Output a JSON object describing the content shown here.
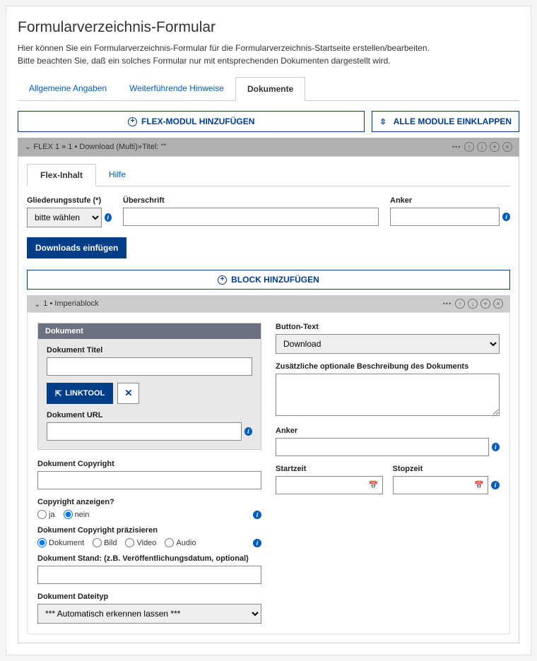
{
  "page": {
    "title": "Formularverzeichnis-Formular",
    "intro1": "Hier können Sie ein Formularverzeichnis-Formular für die Formularverzeichnis-Startseite erstellen/bearbeiten.",
    "intro2": "Bitte beachten Sie, daß ein solches Formular nur mit entsprechenden Dokumenten dargestellt wird."
  },
  "tabs": {
    "t1": "Allgemeine Angaben",
    "t2": "Weiterführende Hinweise",
    "t3": "Dokumente"
  },
  "toolbar": {
    "addFlex": "FLEX-MODUL HINZUFÜGEN",
    "collapseAll": "ALLE MODULE EINKLAPPEN"
  },
  "module": {
    "header": "FLEX 1 »  1 • Download (Multi)»Titel: \"\"",
    "innerTabs": {
      "content": "Flex-Inhalt",
      "help": "Hilfe"
    },
    "fields": {
      "gliederung": "Gliederungsstufe (*)",
      "gliederungSelect": "bitte wählen",
      "ueberschrift": "Überschrift",
      "anker": "Anker"
    },
    "insertDownloads": "Downloads einfügen",
    "addBlock": "BLOCK HINZUFÜGEN"
  },
  "block": {
    "header": "1 • Imperiablock",
    "doc": {
      "boxTitle": "Dokument",
      "titel": "Dokument Titel",
      "linktool": "LINKTOOL",
      "url": "Dokument URL"
    },
    "copyright": "Dokument Copyright",
    "copyrightShow": "Copyright anzeigen?",
    "ja": "ja",
    "nein": "nein",
    "copyrightPrecise": "Dokument Copyright präzisieren",
    "rt": {
      "dokument": "Dokument",
      "bild": "Bild",
      "video": "Video",
      "audio": "Audio"
    },
    "stand": "Dokument Stand: (z.B. Veröffentlichungsdatum, optional)",
    "dateityp": "Dokument Dateityp",
    "dateitypSelect": "*** Automatisch erkennen lassen ***",
    "buttonText": "Button-Text",
    "buttonTextValue": "Download",
    "beschreibung": "Zusätzliche optionale Beschreibung des Dokuments",
    "anker2": "Anker",
    "startzeit": "Startzeit",
    "stopzeit": "Stopzeit"
  }
}
